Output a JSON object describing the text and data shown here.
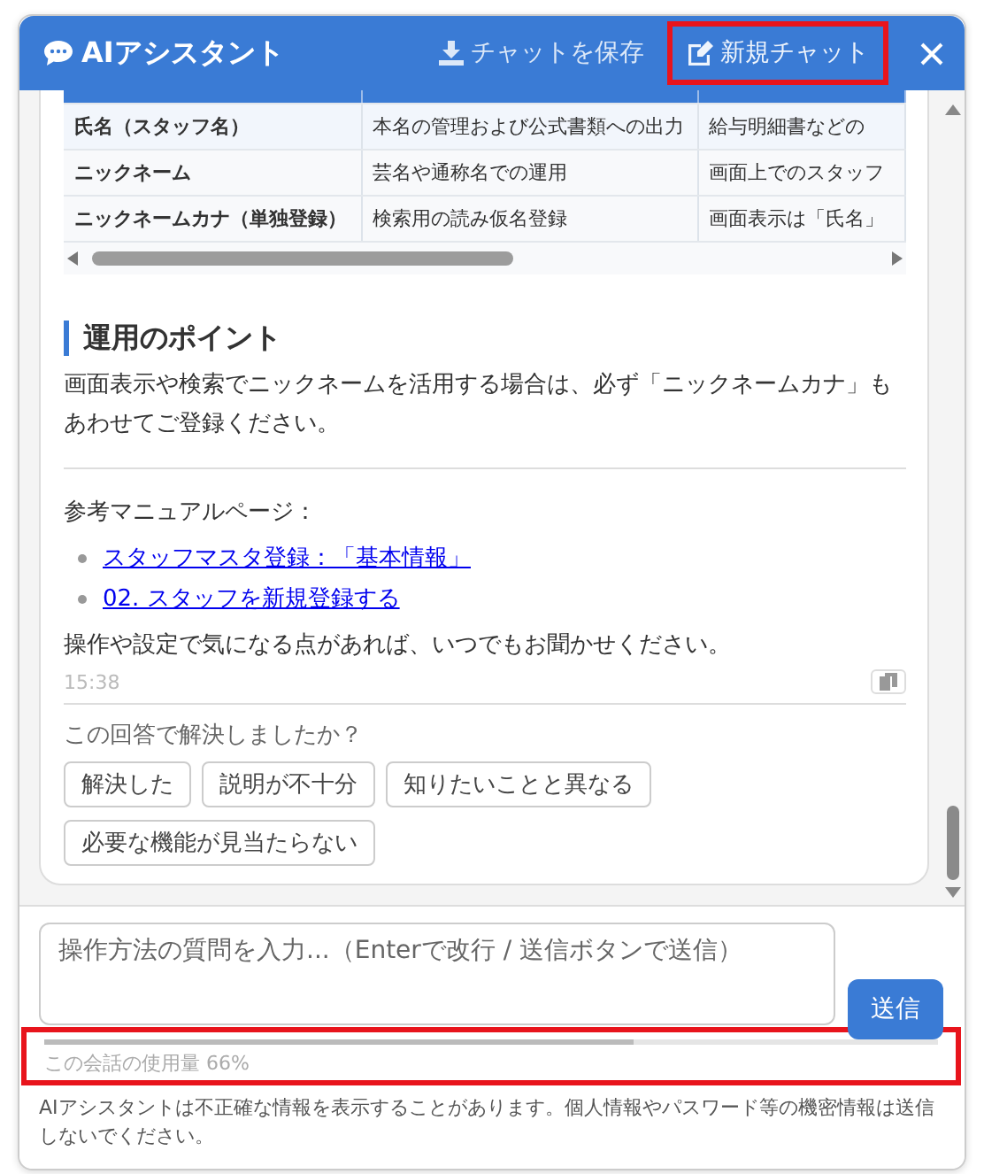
{
  "window": {
    "title": "AIアシスタント"
  },
  "header_actions": [
    {
      "label": "チャットを保存",
      "kind": "save",
      "highlighted": false
    },
    {
      "label": "新規チャット",
      "kind": "new",
      "highlighted": true
    }
  ],
  "message": {
    "table": {
      "rows": [
        [
          "氏名（スタッフ名）",
          "本名の管理および公式書類への出力",
          "給与明細書などの"
        ],
        [
          "ニックネーム",
          "芸名や通称名での運用",
          "画面上でのスタッフ"
        ],
        [
          "ニックネームカナ（単独登録）",
          "検索用の読み仮名登録",
          "画面表示は「氏名」"
        ]
      ]
    },
    "heading": "運用のポイント",
    "paragraph": "画面表示や検索でニックネームを活用する場合は、必ず「ニックネームカナ」もあわせてご登録ください。",
    "reference_label": "参考マニュアルページ：",
    "links": [
      "スタッフマスタ登録：「基本情報」",
      "02. スタッフを新規登録する"
    ],
    "closing": "操作や設定で気になる点があれば、いつでもお聞かせください。",
    "time": "15:38"
  },
  "feedback": {
    "question": "この回答で解決しましたか？",
    "options": [
      "解決した",
      "説明が不十分",
      "知りたいことと異なる",
      "必要な機能が見当たらない"
    ]
  },
  "input": {
    "placeholder": "操作方法の質問を入力...（Enterで改行 / 送信ボタンで送信）"
  },
  "send_button": "送信",
  "usage": {
    "label": "この会話の使用量 66%",
    "level": 0.66,
    "highlighted": true
  },
  "disclaimer": "AIアシスタントは不正確な情報を表示することがあります。個人情報やパスワード等の機密情報は送信しないでください。"
}
